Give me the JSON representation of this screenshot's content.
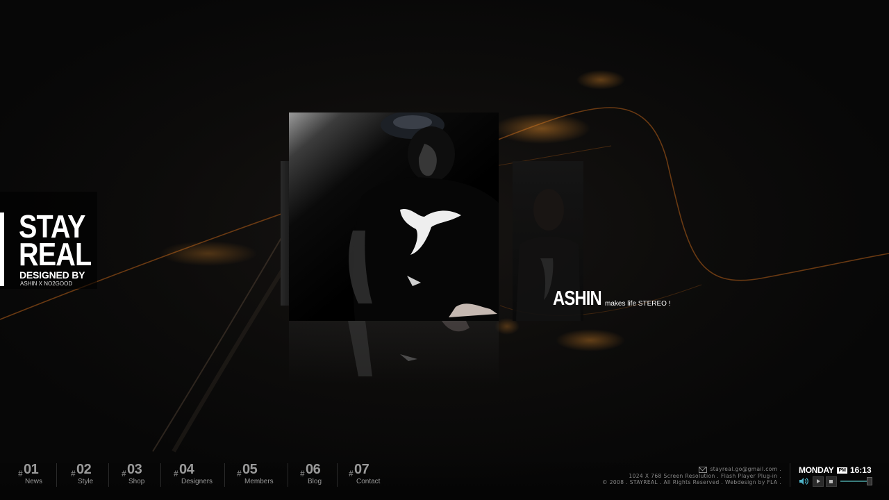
{
  "logo": {
    "line1": "STAY",
    "line2": "REAL",
    "designed_by": "DESIGNED BY",
    "credit": "ASHIN X NO2GOOD"
  },
  "feature": {
    "name": "ASHIN",
    "tagline": "makes life STEREO !"
  },
  "nav": {
    "items": [
      {
        "hash": "#",
        "num": "01",
        "label": "News"
      },
      {
        "hash": "#",
        "num": "02",
        "label": "Style"
      },
      {
        "hash": "#",
        "num": "03",
        "label": "Shop"
      },
      {
        "hash": "#",
        "num": "04",
        "label": "Designers"
      },
      {
        "hash": "#",
        "num": "05",
        "label": "Members"
      },
      {
        "hash": "#",
        "num": "06",
        "label": "Blog"
      },
      {
        "hash": "#",
        "num": "07",
        "label": "Contact"
      }
    ]
  },
  "footer": {
    "email": "stayreal.go@gmail.com .",
    "line2": "1024 X 768 Screen Resolution . Flash Player Plug-in .",
    "line3": "© 2008 . STAYREAL . All Rights Reserved . Webdesign by FLA ."
  },
  "clock": {
    "day": "MONDAY",
    "ampm": "PM",
    "time": "16:13"
  },
  "player": {
    "volume_fraction": 0.9
  },
  "colors": {
    "accent_glow": "#c8741e",
    "volume_track": "#3a7c7c"
  }
}
